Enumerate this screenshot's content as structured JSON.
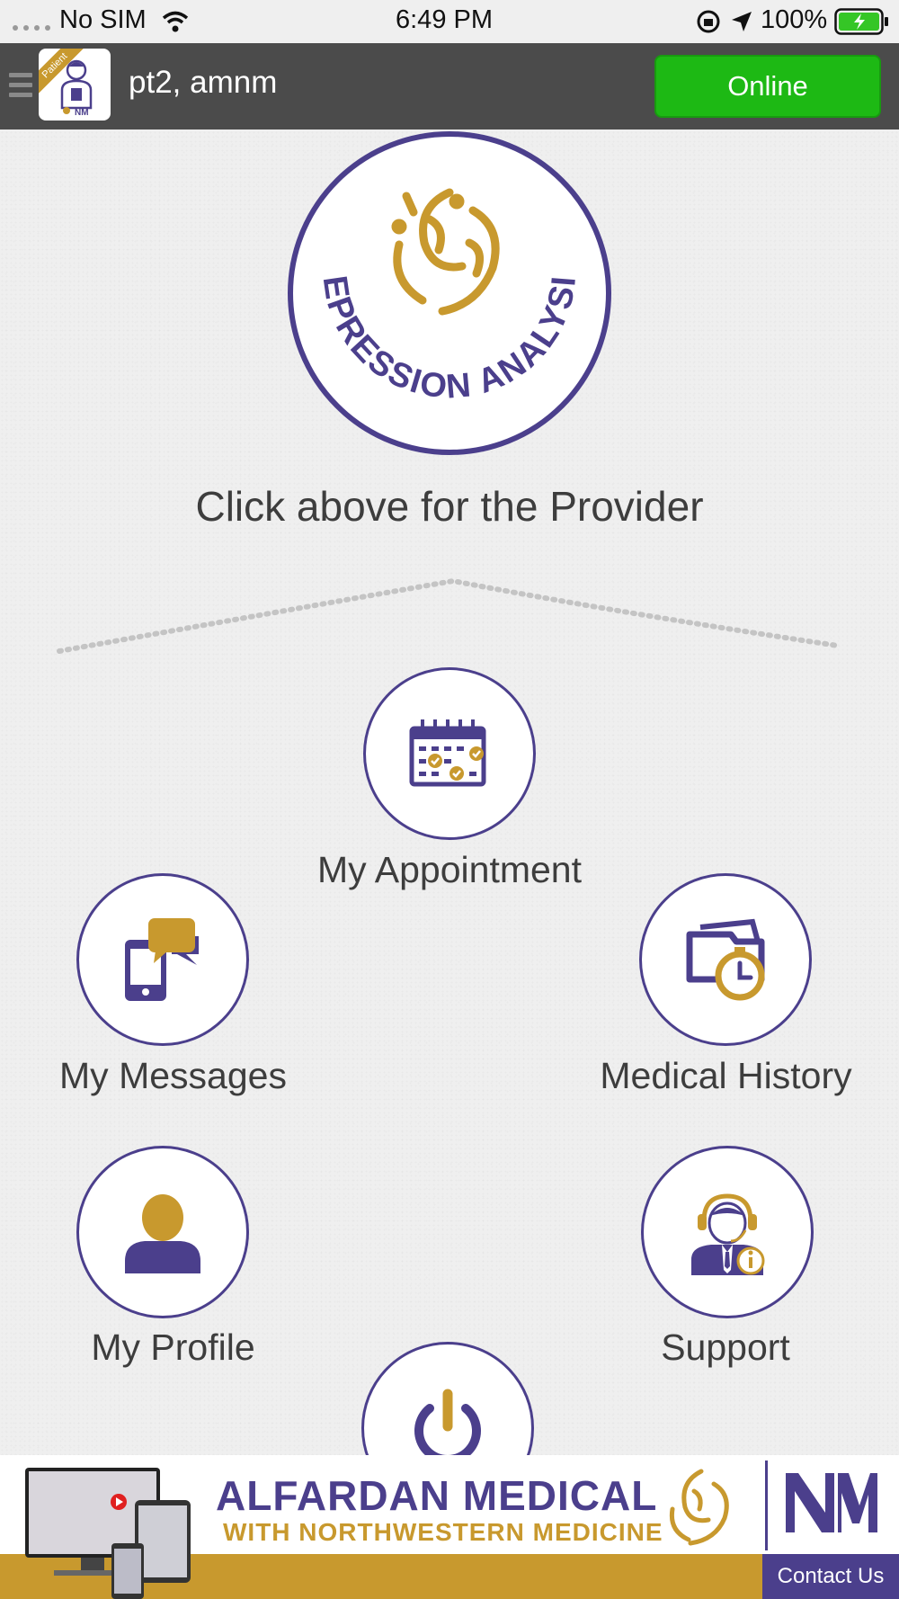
{
  "status_bar": {
    "carrier": "No SIM",
    "time": "6:49 PM",
    "battery": "100%"
  },
  "header": {
    "user_name": "pt2, amnm",
    "status_button": "Online",
    "logo_ribbon": "Patient"
  },
  "provider": {
    "logo_text": "DEPRESSION ANALYSIS",
    "caption": "Click above for the Provider"
  },
  "menu": {
    "appointment": "My Appointment",
    "messages": "My Messages",
    "medical_history": "Medical History",
    "profile": "My Profile",
    "support": "Support"
  },
  "banner": {
    "title": "ALFARDAN MEDICAL",
    "subtitle": "WITH NORTHWESTERN MEDICINE",
    "contact": "Contact Us"
  },
  "colors": {
    "brand_purple": "#4b3f8c",
    "brand_gold": "#c8992e",
    "online_green": "#1db914",
    "header_gray": "#4b4b4b"
  }
}
